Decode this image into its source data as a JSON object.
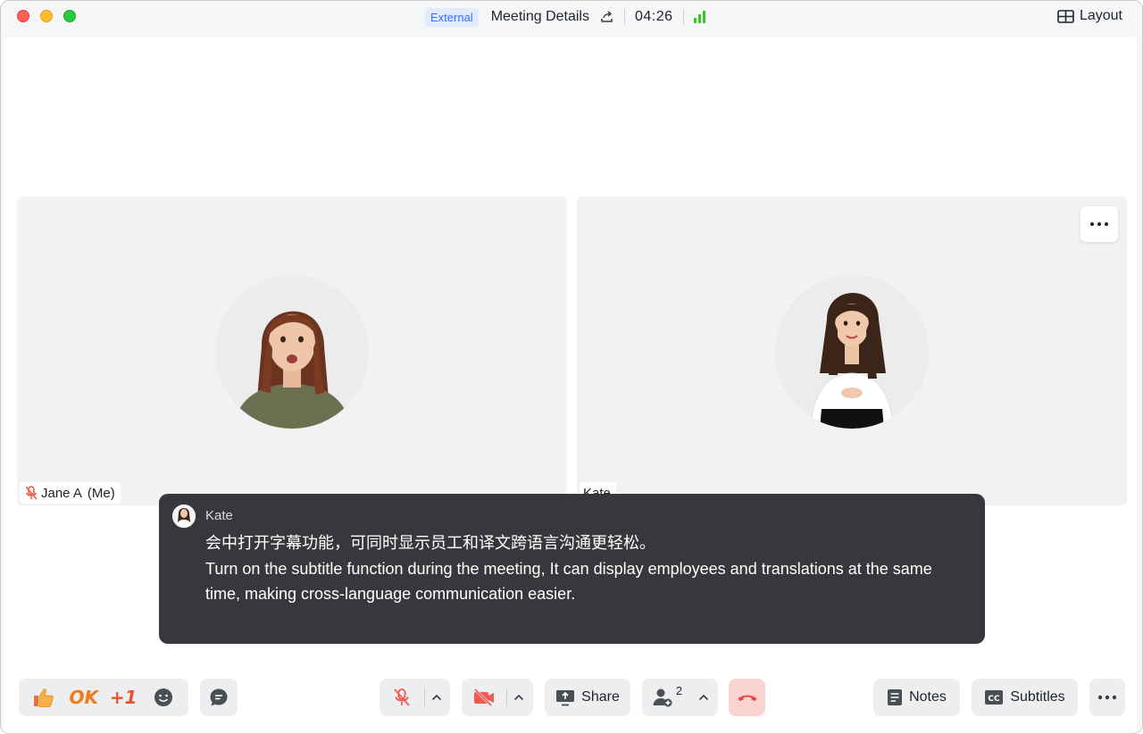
{
  "titlebar": {
    "badge": "External",
    "meeting_details": "Meeting Details",
    "timer": "04:26",
    "layout_label": "Layout"
  },
  "participants": [
    {
      "name": "Jane A",
      "me_suffix": "(Me)",
      "muted": true
    },
    {
      "name": "Kate",
      "muted": false
    }
  ],
  "subtitle": {
    "speaker": "Kate",
    "line_zh": "会中打开字幕功能，可同时显示员工和译文跨语言沟通更轻松。",
    "line_en": "Turn on the subtitle function during the meeting, It can display employees and translations at the same time, making cross-language communication easier."
  },
  "toolbar": {
    "reactions": {
      "ok": "OK",
      "plus_one": "+1"
    },
    "share_label": "Share",
    "participants_count": "2",
    "notes_label": "Notes",
    "subtitles_label": "Subtitles"
  },
  "colors": {
    "accent": "#3370ff",
    "signal": "#34c724",
    "muted_red": "#f05a4f",
    "leave_bg": "#f9d3d0",
    "subtitle_bg": "#37383b"
  },
  "icons": {
    "share_out": "share-out-icon",
    "signal": "signal-strength-icon",
    "layout": "layout-grid-icon",
    "mic_off": "mic-off-icon",
    "camera_off": "camera-off-icon",
    "screen_share": "screen-share-icon",
    "add_participant": "add-participant-icon",
    "hang_up": "phone-hangup-icon",
    "notes": "notes-icon",
    "cc": "cc-icon",
    "more": "more-icon"
  }
}
